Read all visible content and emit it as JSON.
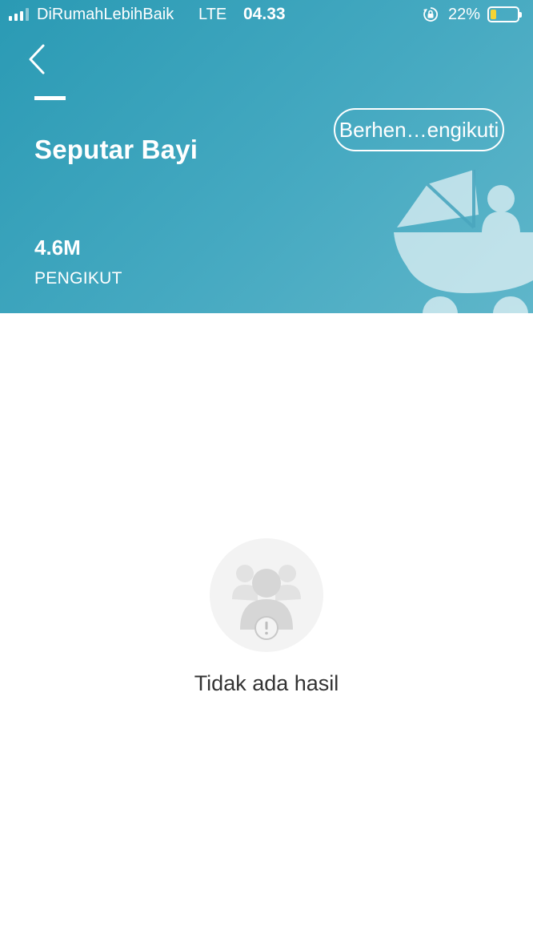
{
  "status_bar": {
    "carrier": "DiRumahLebihBaik",
    "network": "LTE",
    "time": "04.33",
    "battery_percent": "22%",
    "battery_level": 0.22,
    "battery_color": "#f5d432"
  },
  "header": {
    "back_icon": "chevron-left-icon",
    "title": "Seputar Bayi",
    "unfollow_label": "Berhen…engikuti",
    "follower_count": "4.6M",
    "follower_label": "PENGIKUT",
    "illustration": "baby-stroller-icon",
    "gradient_colors": [
      "#2a9ab4",
      "#5fb6ca"
    ]
  },
  "empty_state": {
    "icon": "no-followers-icon",
    "message": "Tidak ada hasil"
  }
}
